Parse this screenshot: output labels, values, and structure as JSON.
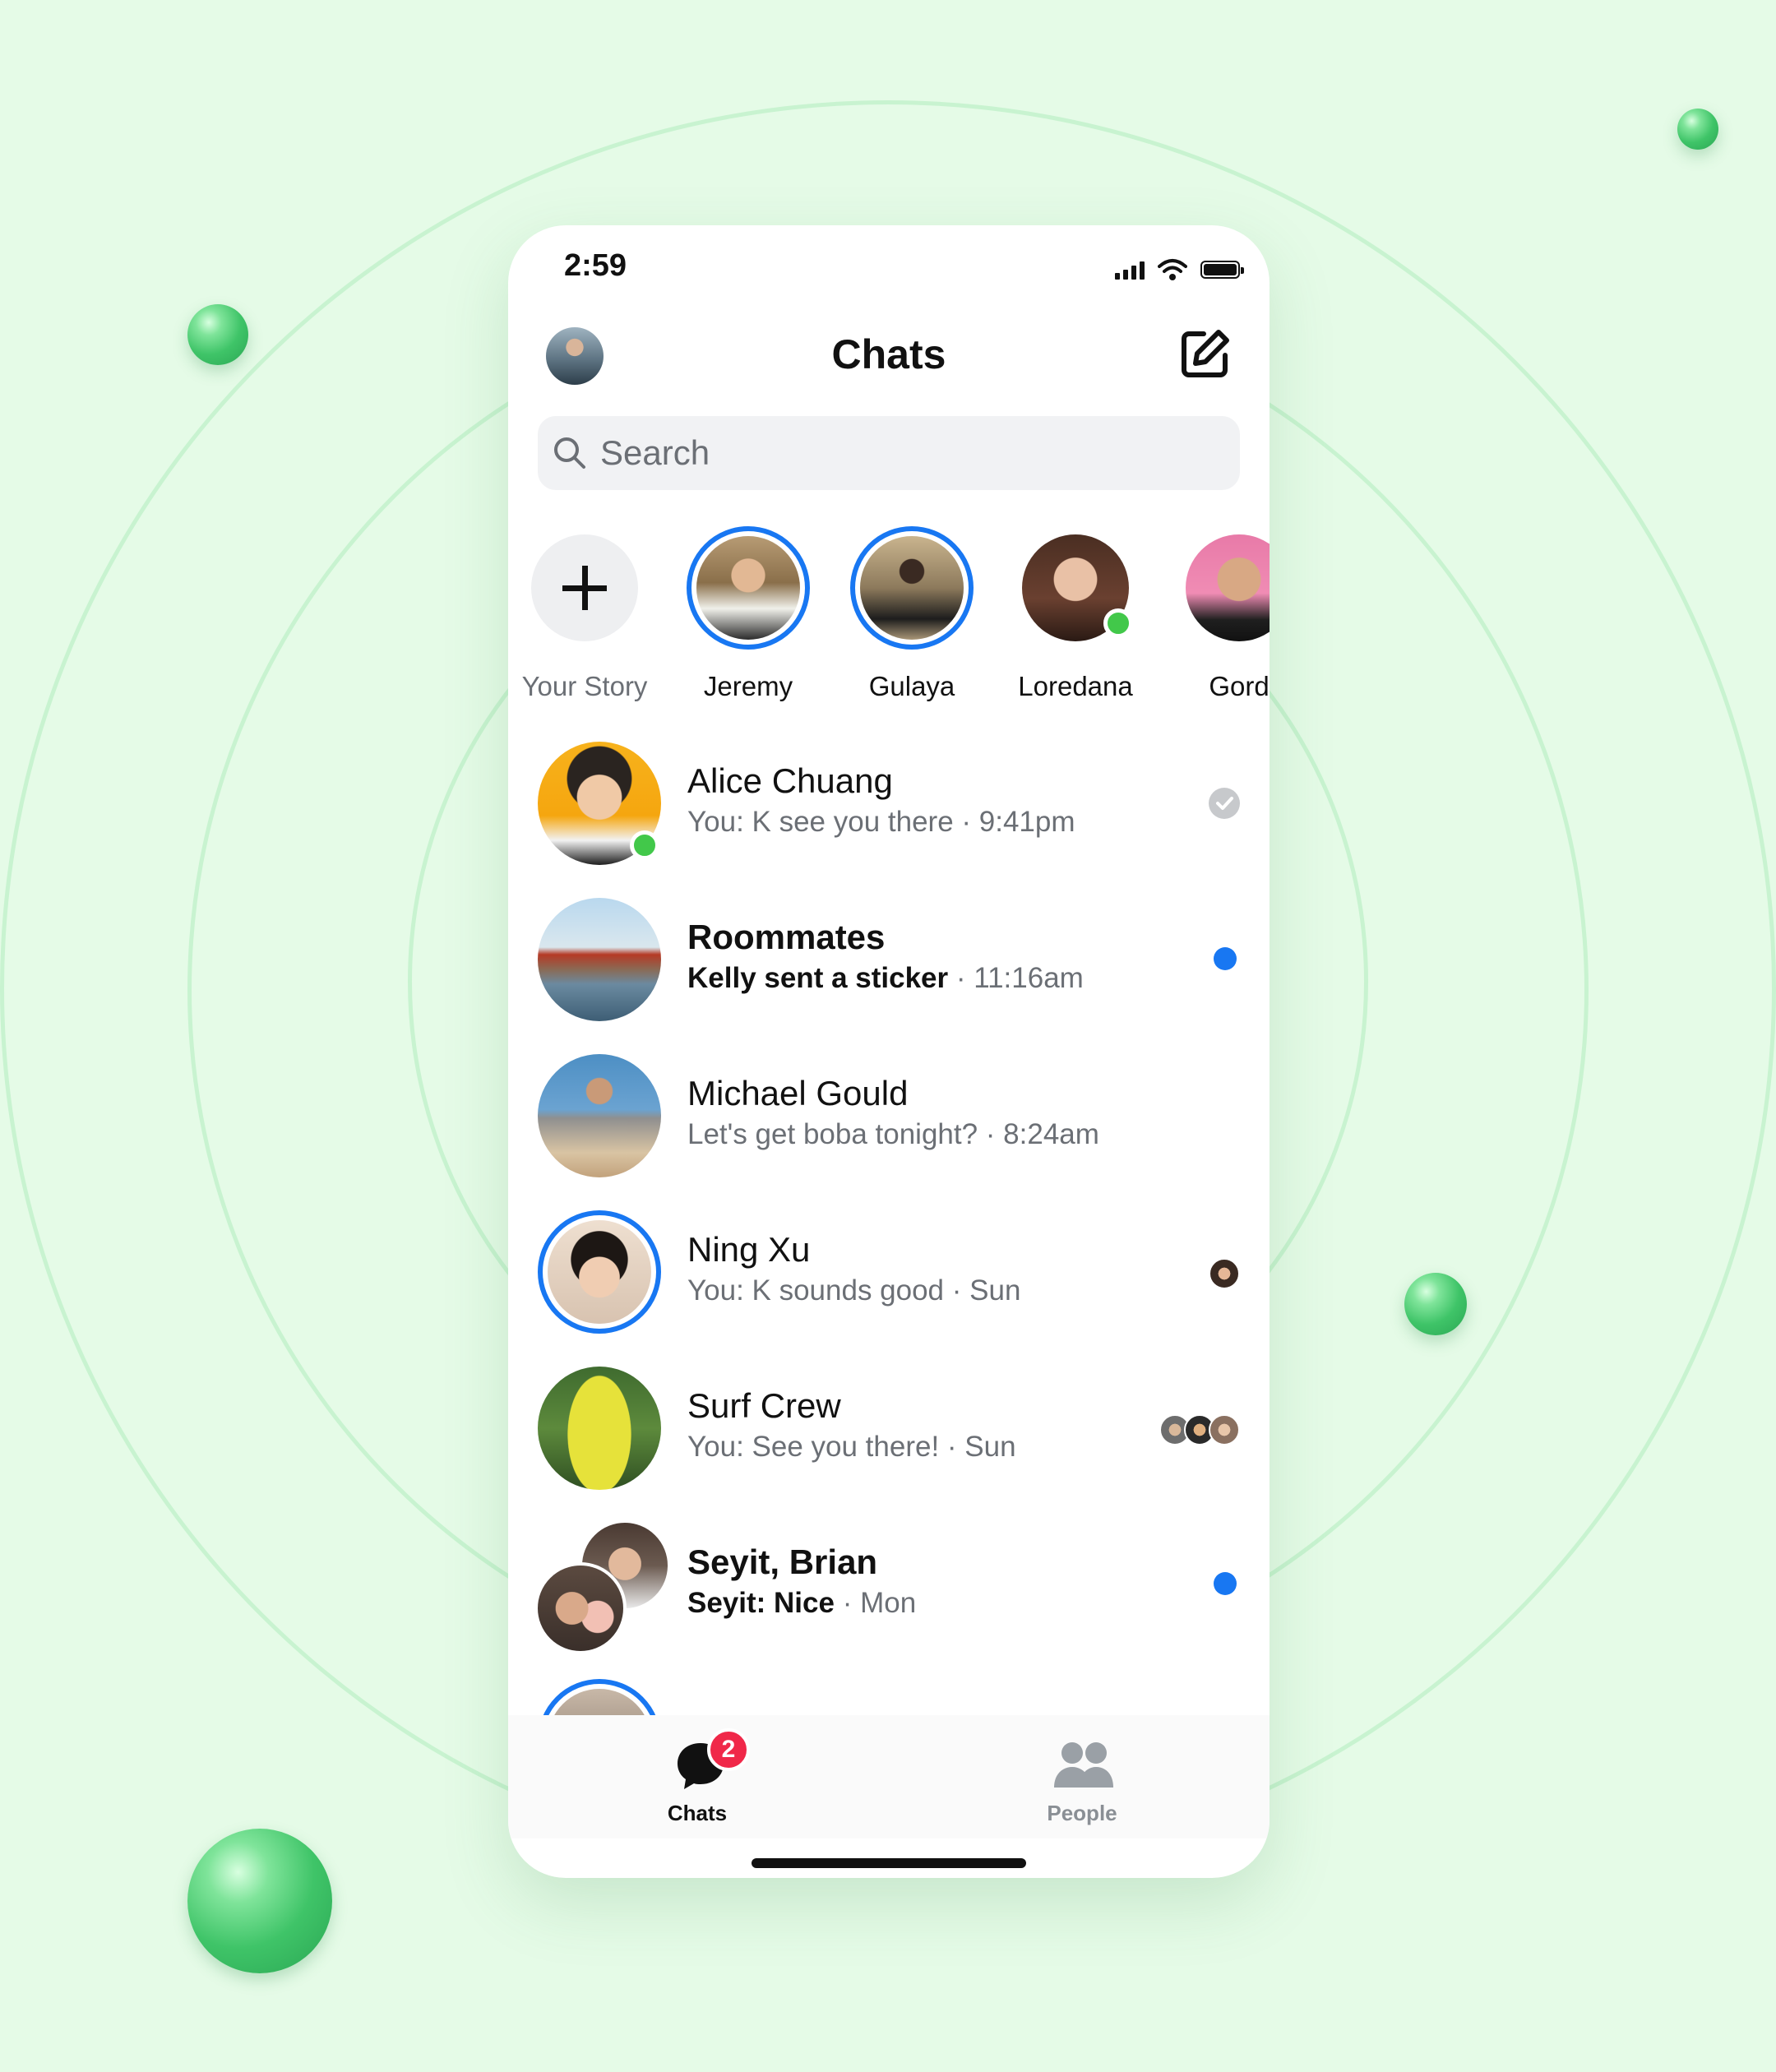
{
  "status": {
    "time": "2:59"
  },
  "header": {
    "title": "Chats"
  },
  "search": {
    "placeholder": "Search"
  },
  "stories": [
    {
      "label": "Your Story"
    },
    {
      "label": "Jeremy"
    },
    {
      "label": "Gulaya"
    },
    {
      "label": "Loredana"
    },
    {
      "label": "Gord"
    }
  ],
  "chats": [
    {
      "name": "Alice Chuang",
      "preview": "You: K see you there",
      "time": " · 9:41pm"
    },
    {
      "name": "Roommates",
      "preview": "Kelly sent a sticker",
      "time": " · 11:16am"
    },
    {
      "name": "Michael Gould",
      "preview": "Let's get boba tonight?",
      "time": " · 8:24am"
    },
    {
      "name": "Ning Xu",
      "preview": "You: K sounds good",
      "time": " · Sun"
    },
    {
      "name": "Surf Crew",
      "preview": "You: See you there!",
      "time": " · Sun"
    },
    {
      "name": "Seyit, Brian",
      "preview": "Seyit: Nice",
      "time": " · Mon"
    }
  ],
  "tabbar": {
    "chats_label": "Chats",
    "chats_badge": "2",
    "people_label": "People"
  },
  "colors": {
    "accent": "#1877f2",
    "online": "#42c84a",
    "badge": "#f02849",
    "background": "#e5fbe7"
  }
}
